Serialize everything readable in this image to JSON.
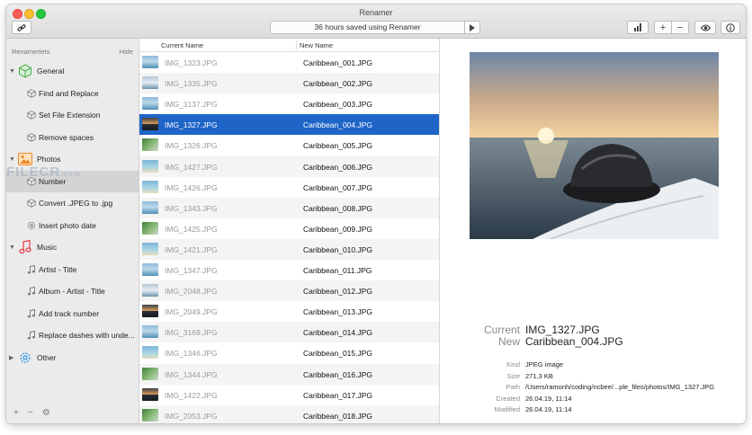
{
  "window": {
    "title": "Renamer"
  },
  "toolbar": {
    "status_text": "36 hours saved using Renamer"
  },
  "sidebar": {
    "header": "Renamerlets",
    "hide_label": "Hide",
    "rows": [
      {
        "type": "category",
        "label": "General",
        "icon": "cube-icon",
        "expanded": true
      },
      {
        "type": "item",
        "label": "Find and Replace",
        "icon": "cube-small-icon"
      },
      {
        "type": "item",
        "label": "Set File Extension",
        "icon": "cube-small-icon"
      },
      {
        "type": "item",
        "label": "Remove spaces",
        "icon": "cube-small-icon"
      },
      {
        "type": "category",
        "label": "Photos",
        "icon": "photo-icon",
        "expanded": true
      },
      {
        "type": "item",
        "label": "Number",
        "icon": "cube-small-icon",
        "selected": true
      },
      {
        "type": "item",
        "label": "Convert .JPEG to .jpg",
        "icon": "cube-small-icon"
      },
      {
        "type": "item",
        "label": "Insert photo date",
        "icon": "gear-small-icon"
      },
      {
        "type": "category",
        "label": "Music",
        "icon": "music-note-icon",
        "expanded": true
      },
      {
        "type": "item",
        "label": "Artist - Title",
        "icon": "music-small-icon"
      },
      {
        "type": "item",
        "label": "Album - Artist - Title",
        "icon": "music-small-icon"
      },
      {
        "type": "item",
        "label": "Add track number",
        "icon": "music-small-icon"
      },
      {
        "type": "item",
        "label": "Replace dashes with unde...",
        "icon": "music-small-icon"
      },
      {
        "type": "category",
        "label": "Other",
        "icon": "gear-icon",
        "expanded": false
      }
    ],
    "footer": {
      "add": "+",
      "remove": "−",
      "gear": "⚙"
    }
  },
  "watermark": {
    "text": "FILECR",
    "sub": ".com"
  },
  "file_list": {
    "columns": {
      "current": "Current Name",
      "new": "New Name"
    },
    "rows": [
      {
        "current": "IMG_1323.JPG",
        "new": "Caribbean_001.JPG",
        "thumb": "sea"
      },
      {
        "current": "IMG_1335.JPG",
        "new": "Caribbean_002.JPG",
        "thumb": "boat"
      },
      {
        "current": "IMG_3137.JPG",
        "new": "Caribbean_003.JPG",
        "thumb": "sea"
      },
      {
        "current": "IMG_1327.JPG",
        "new": "Caribbean_004.JPG",
        "thumb": "sunset",
        "selected": true
      },
      {
        "current": "IMG_1326.JPG",
        "new": "Caribbean_005.JPG",
        "thumb": "palm"
      },
      {
        "current": "IMG_1427.JPG",
        "new": "Caribbean_006.JPG",
        "thumb": "beach"
      },
      {
        "current": "IMG_1426.JPG",
        "new": "Caribbean_007.JPG",
        "thumb": "beach"
      },
      {
        "current": "IMG_1343.JPG",
        "new": "Caribbean_008.JPG",
        "thumb": "sea"
      },
      {
        "current": "IMG_1425.JPG",
        "new": "Caribbean_009.JPG",
        "thumb": "palm"
      },
      {
        "current": "IMG_1421.JPG",
        "new": "Caribbean_010.JPG",
        "thumb": "beach"
      },
      {
        "current": "IMG_1347.JPG",
        "new": "Caribbean_011.JPG",
        "thumb": "sea"
      },
      {
        "current": "IMG_2048.JPG",
        "new": "Caribbean_012.JPG",
        "thumb": "boat"
      },
      {
        "current": "IMG_2049.JPG",
        "new": "Caribbean_013.JPG",
        "thumb": "sunset"
      },
      {
        "current": "IMG_3169.JPG",
        "new": "Caribbean_014.JPG",
        "thumb": "sea"
      },
      {
        "current": "IMG_1346.JPG",
        "new": "Caribbean_015.JPG",
        "thumb": "beach"
      },
      {
        "current": "IMG_1344.JPG",
        "new": "Caribbean_016.JPG",
        "thumb": "palm"
      },
      {
        "current": "IMG_1422.JPG",
        "new": "Caribbean_017.JPG",
        "thumb": "sunset"
      },
      {
        "current": "IMG_2053.JPG",
        "new": "Caribbean_018.JPG",
        "thumb": "palm"
      }
    ]
  },
  "detail": {
    "current_label": "Current",
    "current_value": "IMG_1327.JPG",
    "new_label": "New",
    "new_value": "Caribbean_004.JPG",
    "meta": [
      {
        "label": "Kind",
        "value": "JPEG image"
      },
      {
        "label": "Size",
        "value": "271,3 KB"
      },
      {
        "label": "Path",
        "value": "/Users/ramonh/coding/ncbee/...ple_files/photos/IMG_1327.JPG"
      },
      {
        "label": "Created",
        "value": "26.04.19, 11:14"
      },
      {
        "label": "Modified",
        "value": "26.04.19, 11:14"
      }
    ]
  },
  "colors": {
    "selection": "#1f65c8",
    "sidebar_bg": "#ebebeb"
  }
}
